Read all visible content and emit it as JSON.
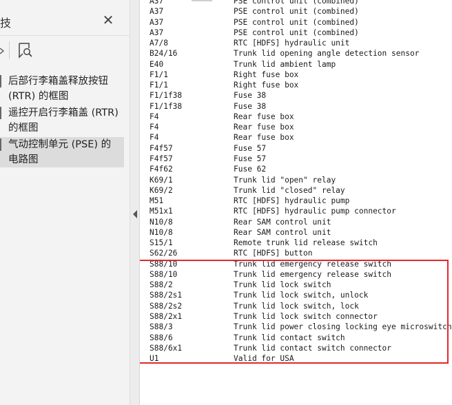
{
  "sidebar": {
    "title_stub": "技",
    "items": [
      {
        "label": "后部行李箱盖释放按钮 (RTR) 的框图",
        "selected": false
      },
      {
        "label": "遥控开启行李箱盖 (RTR) 的框图",
        "selected": false
      },
      {
        "label": "气动控制单元 (PSE) 的电路图",
        "selected": true
      }
    ],
    "close_icon": "close-icon",
    "bookmark_icon": "bookmark-icon",
    "chevron_icon": "chevron-down-icon"
  },
  "splitter": {
    "icon": "collapse-left-icon"
  },
  "document": {
    "rows": [
      {
        "code": "A37",
        "desc": "PSE control unit (combined)"
      },
      {
        "code": "A37",
        "desc": "PSE control unit (combined)"
      },
      {
        "code": "A37",
        "desc": "PSE control unit (combined)"
      },
      {
        "code": "A37",
        "desc": "PSE control unit (combined)"
      },
      {
        "code": "A7/8",
        "desc": "RTC [HDFS] hydraulic unit"
      },
      {
        "code": "B24/16",
        "desc": "Trunk lid opening angle detection sensor"
      },
      {
        "code": "E40",
        "desc": "Trunk lid ambient lamp"
      },
      {
        "code": "F1/1",
        "desc": "Right fuse box"
      },
      {
        "code": "F1/1",
        "desc": "Right fuse box"
      },
      {
        "code": "F1/1f38",
        "desc": "Fuse 38"
      },
      {
        "code": "F1/1f38",
        "desc": "Fuse 38"
      },
      {
        "code": "F4",
        "desc": "Rear fuse box"
      },
      {
        "code": "F4",
        "desc": "Rear fuse box"
      },
      {
        "code": "F4",
        "desc": "Rear fuse box"
      },
      {
        "code": "F4f57",
        "desc": "Fuse 57"
      },
      {
        "code": "F4f57",
        "desc": "Fuse 57"
      },
      {
        "code": "F4f62",
        "desc": "Fuse 62"
      },
      {
        "code": "K69/1",
        "desc": "Trunk lid \"open\" relay"
      },
      {
        "code": "K69/2",
        "desc": "Trunk lid \"closed\" relay"
      },
      {
        "code": "M51",
        "desc": "RTC [HDFS] hydraulic pump"
      },
      {
        "code": "M51x1",
        "desc": "RTC [HDFS] hydraulic pump connector"
      },
      {
        "code": "N10/8",
        "desc": "Rear SAM control unit"
      },
      {
        "code": "N10/8",
        "desc": "Rear SAM control unit"
      },
      {
        "code": "S15/1",
        "desc": "Remote trunk lid release switch"
      },
      {
        "code": "S62/26",
        "desc": "RTC [HDFS] button"
      },
      {
        "code": "S88/10",
        "desc": "Trunk lid emergency release switch"
      },
      {
        "code": "S88/10",
        "desc": "Trunk lid emergency release switch"
      },
      {
        "code": "S88/2",
        "desc": "Trunk lid lock switch"
      },
      {
        "code": "S88/2s1",
        "desc": "Trunk lid lock switch, unlock"
      },
      {
        "code": "S88/2s2",
        "desc": "Trunk lid lock switch, lock"
      },
      {
        "code": "S88/2x1",
        "desc": "Trunk lid lock switch connector"
      },
      {
        "code": "S88/3",
        "desc": "Trunk lid power closing locking eye microswitch"
      },
      {
        "code": "S88/6",
        "desc": "Trunk lid contact switch"
      },
      {
        "code": "S88/6x1",
        "desc": "Trunk lid contact switch connector"
      },
      {
        "code": "U1",
        "desc": "Valid for USA"
      }
    ],
    "highlight_color": "#e0262b"
  }
}
